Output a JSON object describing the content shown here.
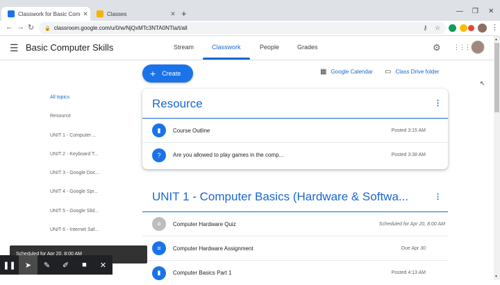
{
  "browser": {
    "tabs": [
      {
        "title": "Classwork for Basic Computer Sk",
        "favicon_color": "#1a73e8"
      },
      {
        "title": "Classes",
        "favicon_color": "#f4b400"
      }
    ],
    "new_tab": "+",
    "window_controls": {
      "minimize": "—",
      "maximize": "❐",
      "close": "✕"
    },
    "url": "classroom.google.com/u/0/w/NjQxMTc3NTA0NTla/t/all",
    "nav": {
      "back": "←",
      "forward": "→",
      "reload": "↻"
    },
    "icons": [
      "key-icon",
      "star-icon",
      "extension-icon",
      "menu-icon"
    ]
  },
  "header": {
    "menu_icon": "☰",
    "class_name": "Basic Computer Skills",
    "tabs": [
      "Stream",
      "Classwork",
      "People",
      "Grades"
    ],
    "active_tab": "Classwork",
    "settings_icon": "⚙",
    "apps_icon": "⋮⋮⋮"
  },
  "sidebar": {
    "items": [
      "All topics",
      "Resource",
      "UNIT 1 - Computer ...",
      "UNIT 2 - Keyboard T...",
      "UNIT 3 - Google Doc...",
      "UNIT 4 - Google Spr...",
      "UNIT 5 - Google Slid...",
      "UNIT 6 - Internet Saf..."
    ],
    "active_index": 0
  },
  "actions": {
    "create_label": "Create",
    "calendar_label": "Google Calendar",
    "drive_label": "Class Drive folder"
  },
  "topics": [
    {
      "title": "Resource",
      "items": [
        {
          "title": "Course Outline",
          "date": "Posted 3:15 AM",
          "icon": "material-icon"
        },
        {
          "title": "Are you allowed to play games in the comp...",
          "date": "Posted 3:38 AM",
          "icon": "question-icon"
        }
      ]
    },
    {
      "title": "UNIT 1 - Computer Basics (Hardware & Softwa...",
      "items": [
        {
          "title": "Computer Hardware Quiz",
          "date": "Scheduled for Apr 20, 8:00 AM",
          "icon": "assignment-icon",
          "scheduled": true
        },
        {
          "title": "Computer Hardware Assignment",
          "date": "Due Apr 30",
          "icon": "assignment-icon"
        },
        {
          "title": "Computer Basics Part 1",
          "date": "Posted 4:13 AM",
          "icon": "material-icon"
        }
      ]
    }
  ],
  "toast": "Scheduled for Apr 20, 8:00 AM",
  "colors": {
    "accent": "#1967d2",
    "button": "#1a73e8"
  }
}
